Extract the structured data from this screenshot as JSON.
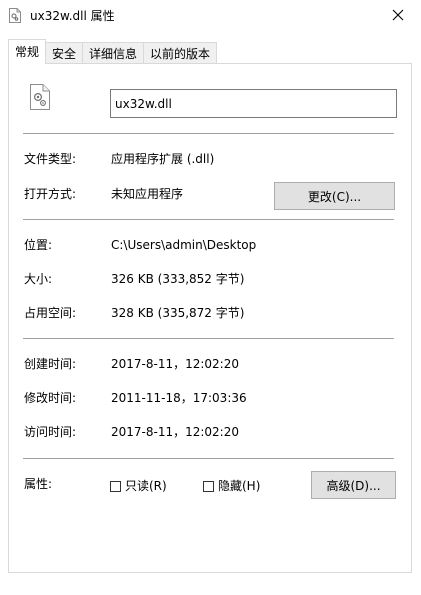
{
  "window": {
    "title": "ux32w.dll 属性",
    "close_icon": "close-icon"
  },
  "tabs": [
    {
      "label": "常规",
      "active": true
    },
    {
      "label": "安全",
      "active": false
    },
    {
      "label": "详细信息",
      "active": false
    },
    {
      "label": "以前的版本",
      "active": false
    }
  ],
  "general": {
    "file_icon": "dll-file-icon",
    "filename": "ux32w.dll",
    "type_label": "文件类型:",
    "type_value": "应用程序扩展 (.dll)",
    "opens_with_label": "打开方式:",
    "opens_with_value": "未知应用程序",
    "change_button": "更改(C)...",
    "location_label": "位置:",
    "location_value": "C:\\Users\\admin\\Desktop",
    "size_label": "大小:",
    "size_value": "326 KB (333,852 字节)",
    "size_on_disk_label": "占用空间:",
    "size_on_disk_value": "328 KB (335,872 字节)",
    "created_label": "创建时间:",
    "created_value": "2017-8-11，12:02:20",
    "modified_label": "修改时间:",
    "modified_value": "2011-11-18，17:03:36",
    "accessed_label": "访问时间:",
    "accessed_value": "2017-8-11，12:02:20",
    "attributes_label": "属性:",
    "readonly_label": "只读(R)",
    "readonly_checked": false,
    "hidden_label": "隐藏(H)",
    "hidden_checked": false,
    "advanced_button": "高级(D)..."
  }
}
